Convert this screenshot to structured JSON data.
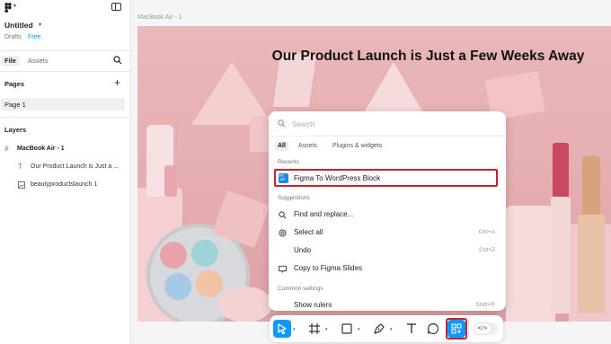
{
  "sidebar": {
    "file_title": "Untitled",
    "drafts": "Drafts",
    "plan": "Free",
    "tabs": [
      "File",
      "Assets"
    ],
    "pages_heading": "Pages",
    "pages": [
      "Page 1"
    ],
    "layers_heading": "Layers",
    "layers": [
      {
        "name": "MacBook Air - 1",
        "icon": "hash-icon"
      },
      {
        "name": "Our Product Launch is Just a ...",
        "icon": "text-icon"
      },
      {
        "name": "beautyproductslaunch 1",
        "icon": "image-icon"
      }
    ]
  },
  "canvas": {
    "frame_label": "MacBook Air - 1",
    "headline": "Our Product Launch is Just a Few Weeks Away"
  },
  "popup": {
    "search_placeholder": "Search",
    "tabs": [
      "All",
      "Assets",
      "Plugins & widgets"
    ],
    "recents_label": "Recents",
    "recent_items": [
      {
        "label": "Figma To WordPress Block",
        "icon": "plugin-icon"
      }
    ],
    "suggestions_label": "Suggestions",
    "suggestions": [
      {
        "label": "Find and replace...",
        "icon": "search-icon",
        "shortcut": ""
      },
      {
        "label": "Select all",
        "icon": "target-icon",
        "shortcut": "Ctrl+A"
      },
      {
        "label": "Undo",
        "icon": "",
        "shortcut": "Ctrl+Z"
      },
      {
        "label": "Copy to Figma Slides",
        "icon": "slides-icon",
        "shortcut": ""
      }
    ],
    "common_label": "Common settings",
    "common": [
      {
        "label": "Show rulers",
        "icon": "",
        "shortcut": "Shift+R"
      }
    ]
  },
  "toolbar": {
    "tools": [
      "move-icon",
      "frame-icon",
      "rectangle-icon",
      "pen-icon",
      "text-icon",
      "comment-icon",
      "actions-icon"
    ],
    "code_toggle": "</>"
  },
  "colors": {
    "accent": "#0d99ff",
    "highlight": "#c8242b",
    "canvas_bg": "#e9b8b9"
  }
}
